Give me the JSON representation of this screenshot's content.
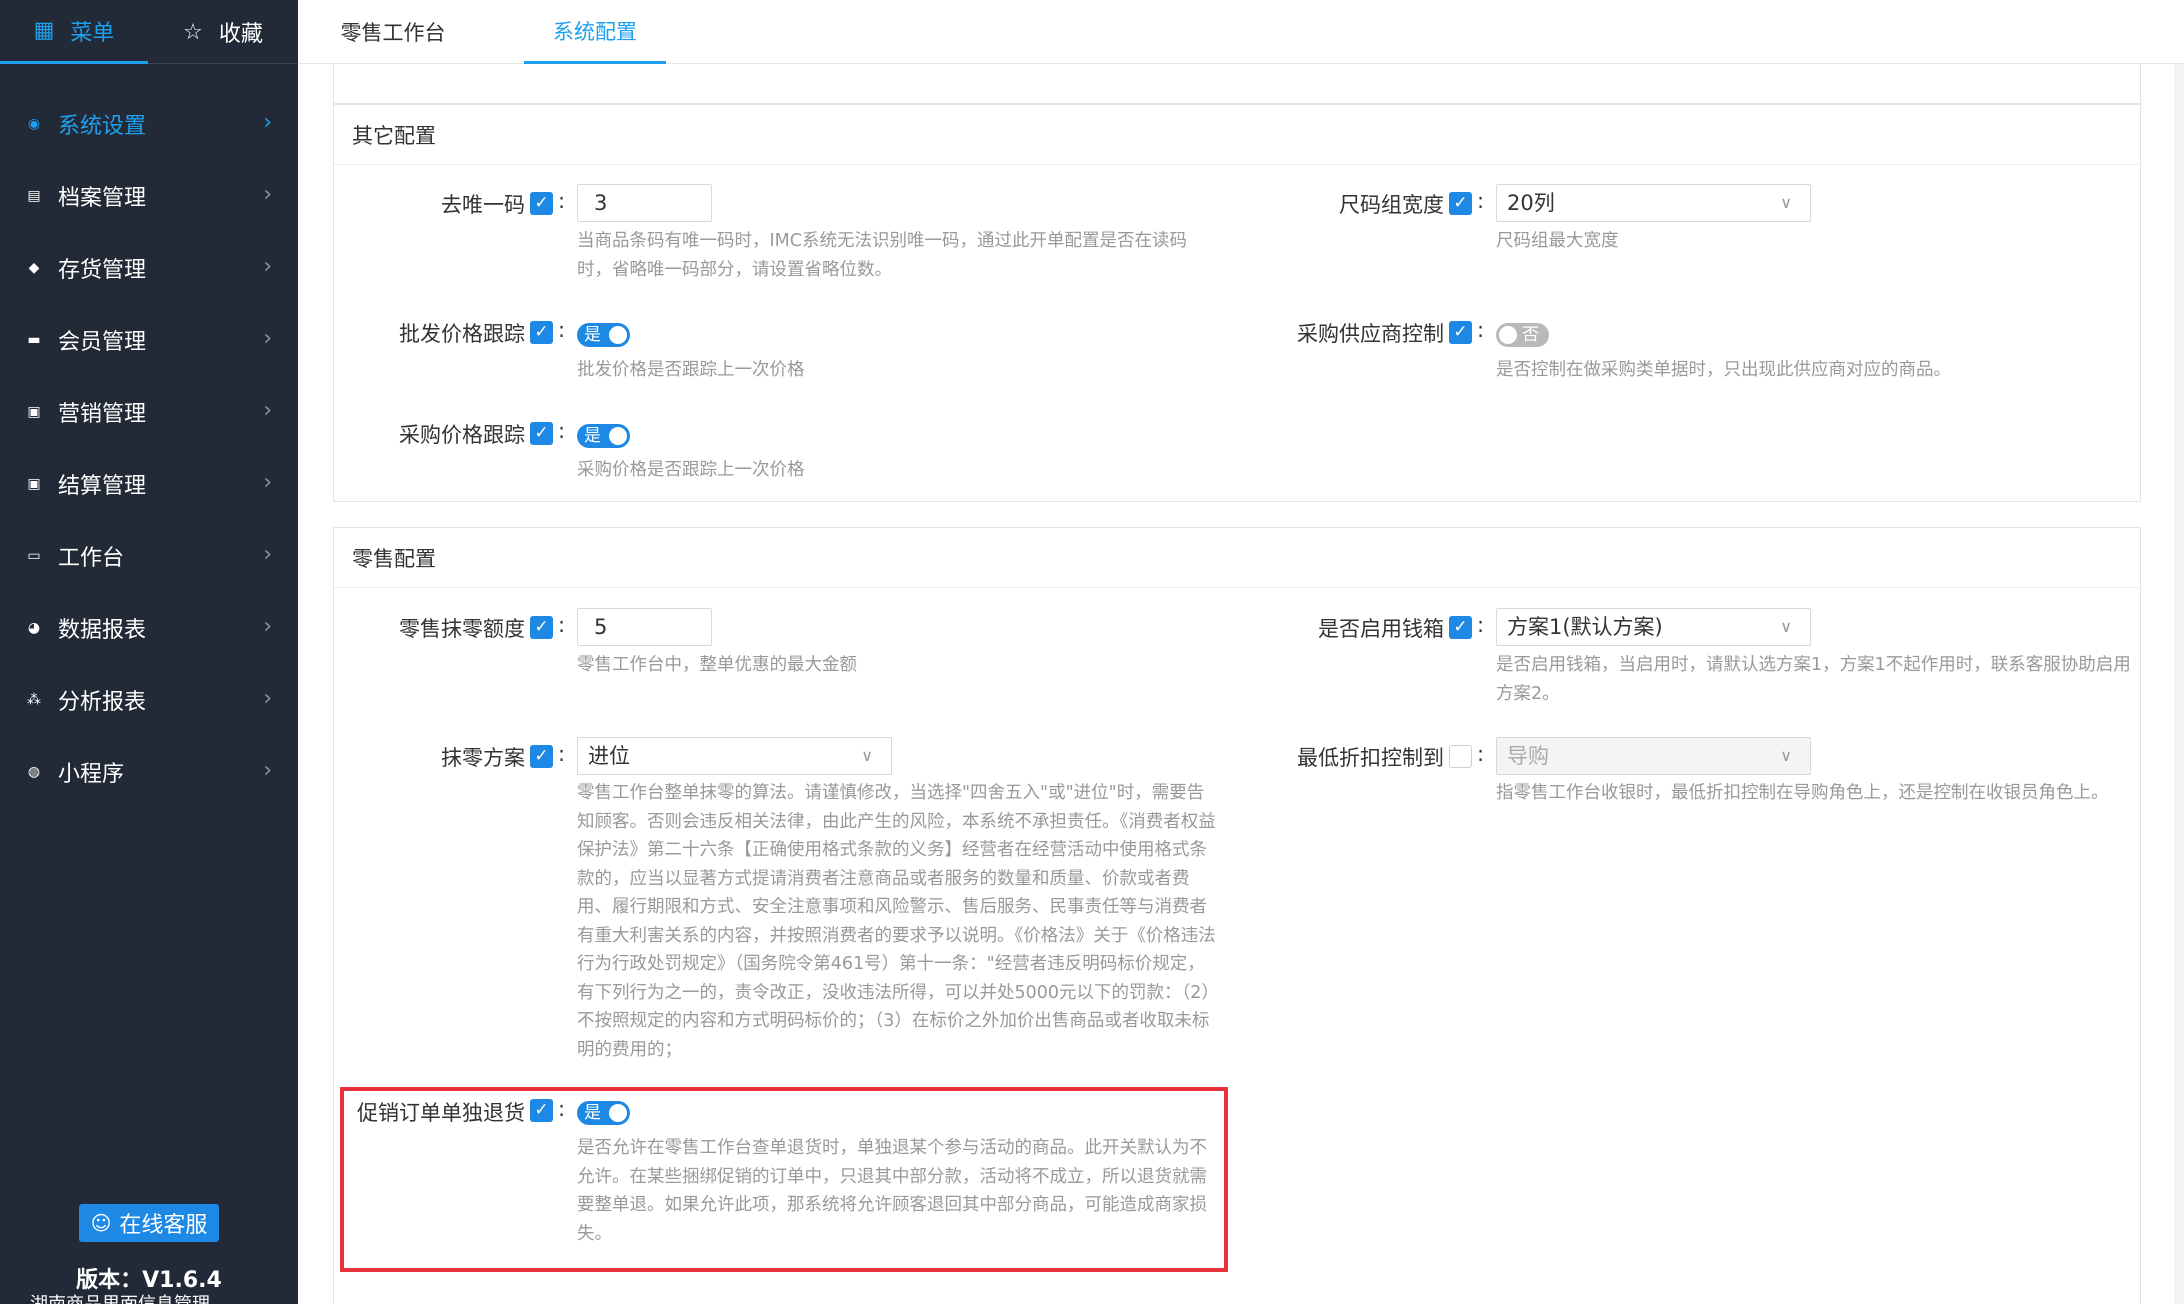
{
  "sidebar": {
    "tabs": [
      {
        "label": "菜单",
        "icon": "grid-icon"
      },
      {
        "label": "收藏",
        "icon": "star-icon"
      }
    ],
    "items": [
      {
        "label": "系统设置",
        "icon": "settings-icon",
        "active": true
      },
      {
        "label": "档案管理",
        "icon": "archive-icon"
      },
      {
        "label": "存货管理",
        "icon": "cube-icon"
      },
      {
        "label": "会员管理",
        "icon": "member-card-icon"
      },
      {
        "label": "营销管理",
        "icon": "gift-icon"
      },
      {
        "label": "结算管理",
        "icon": "wallet-icon"
      },
      {
        "label": "工作台",
        "icon": "chart-icon"
      },
      {
        "label": "数据报表",
        "icon": "pie-icon"
      },
      {
        "label": "分析报表",
        "icon": "share-icon"
      },
      {
        "label": "小程序",
        "icon": "compass-icon"
      }
    ],
    "service_label": "在线客服",
    "version": "版本：V1.6.4",
    "version_cut": "湖南商品里面信息管理"
  },
  "tabs": [
    {
      "label": "零售工作台"
    },
    {
      "label": "系统配置",
      "active": true
    }
  ],
  "other_config": {
    "title": "其它配置",
    "remove_unique_code": {
      "label": "去唯一码",
      "value": "3",
      "help": "当商品条码有唯一码时，IMC系统无法识别唯一码，通过此开单配置是否在读码时，省略唯一码部分，请设置省略位数。"
    },
    "size_group_width": {
      "label": "尺码组宽度",
      "value": "20列",
      "help": "尺码组最大宽度"
    },
    "wholesale_price_track": {
      "label": "批发价格跟踪",
      "value": "是",
      "help": "批发价格是否跟踪上一次价格"
    },
    "purchase_supplier_control": {
      "label": "采购供应商控制",
      "value": "否",
      "help": "是否控制在做采购类单据时，只出现此供应商对应的商品。"
    },
    "purchase_price_track": {
      "label": "采购价格跟踪",
      "value": "是",
      "help": "采购价格是否跟踪上一次价格"
    }
  },
  "retail_config": {
    "title": "零售配置",
    "rounding_amount": {
      "label": "零售抹零额度",
      "value": "5",
      "help": "零售工作台中，整单优惠的最大金额"
    },
    "cash_box": {
      "label": "是否启用钱箱",
      "value": "方案1(默认方案)",
      "help": "是否启用钱箱，当启用时，请默认选方案1，方案1不起作用时，联系客服协助启用方案2。"
    },
    "rounding_scheme": {
      "label": "抹零方案",
      "value": "进位",
      "help": "零售工作台整单抹零的算法。请谨慎修改，当选择\"四舍五入\"或\"进位\"时，需要告知顾客。否则会违反相关法律，由此产生的风险，本系统不承担责任。《消费者权益保护法》第二十六条【正确使用格式条款的义务】经营者在经营活动中使用格式条款的，应当以显著方式提请消费者注意商品或者服务的数量和质量、价款或者费用、履行期限和方式、安全注意事项和风险警示、售后服务、民事责任等与消费者有重大利害关系的内容，并按照消费者的要求予以说明。《价格法》关于《价格违法行为行政处罚规定》（国务院令第461号）第十一条：\"经营者违反明码标价规定，有下列行为之一的，责令改正，没收违法所得，可以并处5000元以下的罚款：（2）不按照规定的内容和方式明码标价的；（3）在标价之外加价出售商品或者收取未标明的费用的；"
    },
    "min_discount_control": {
      "label": "最低折扣控制到",
      "value": "导购",
      "help": "指零售工作台收银时，最低折扣控制在导购角色上，还是控制在收银员角色上。"
    },
    "promo_order_return": {
      "label": "促销订单单独退货",
      "value": "是",
      "help": "是否允许在零售工作台查单退货时，单独退某个参与活动的商品。此开关默认为不允许。在某些捆绑促销的订单中，只退其中部分款，活动将不成立，所以退货就需要整单退。如果允许此项，那系统将允许顾客退回其中部分商品，可能造成商家损失。"
    }
  },
  "colors": {
    "accent": "#1e88e5",
    "sidebar_bg": "#222a37",
    "highlight": "#e8303a"
  }
}
